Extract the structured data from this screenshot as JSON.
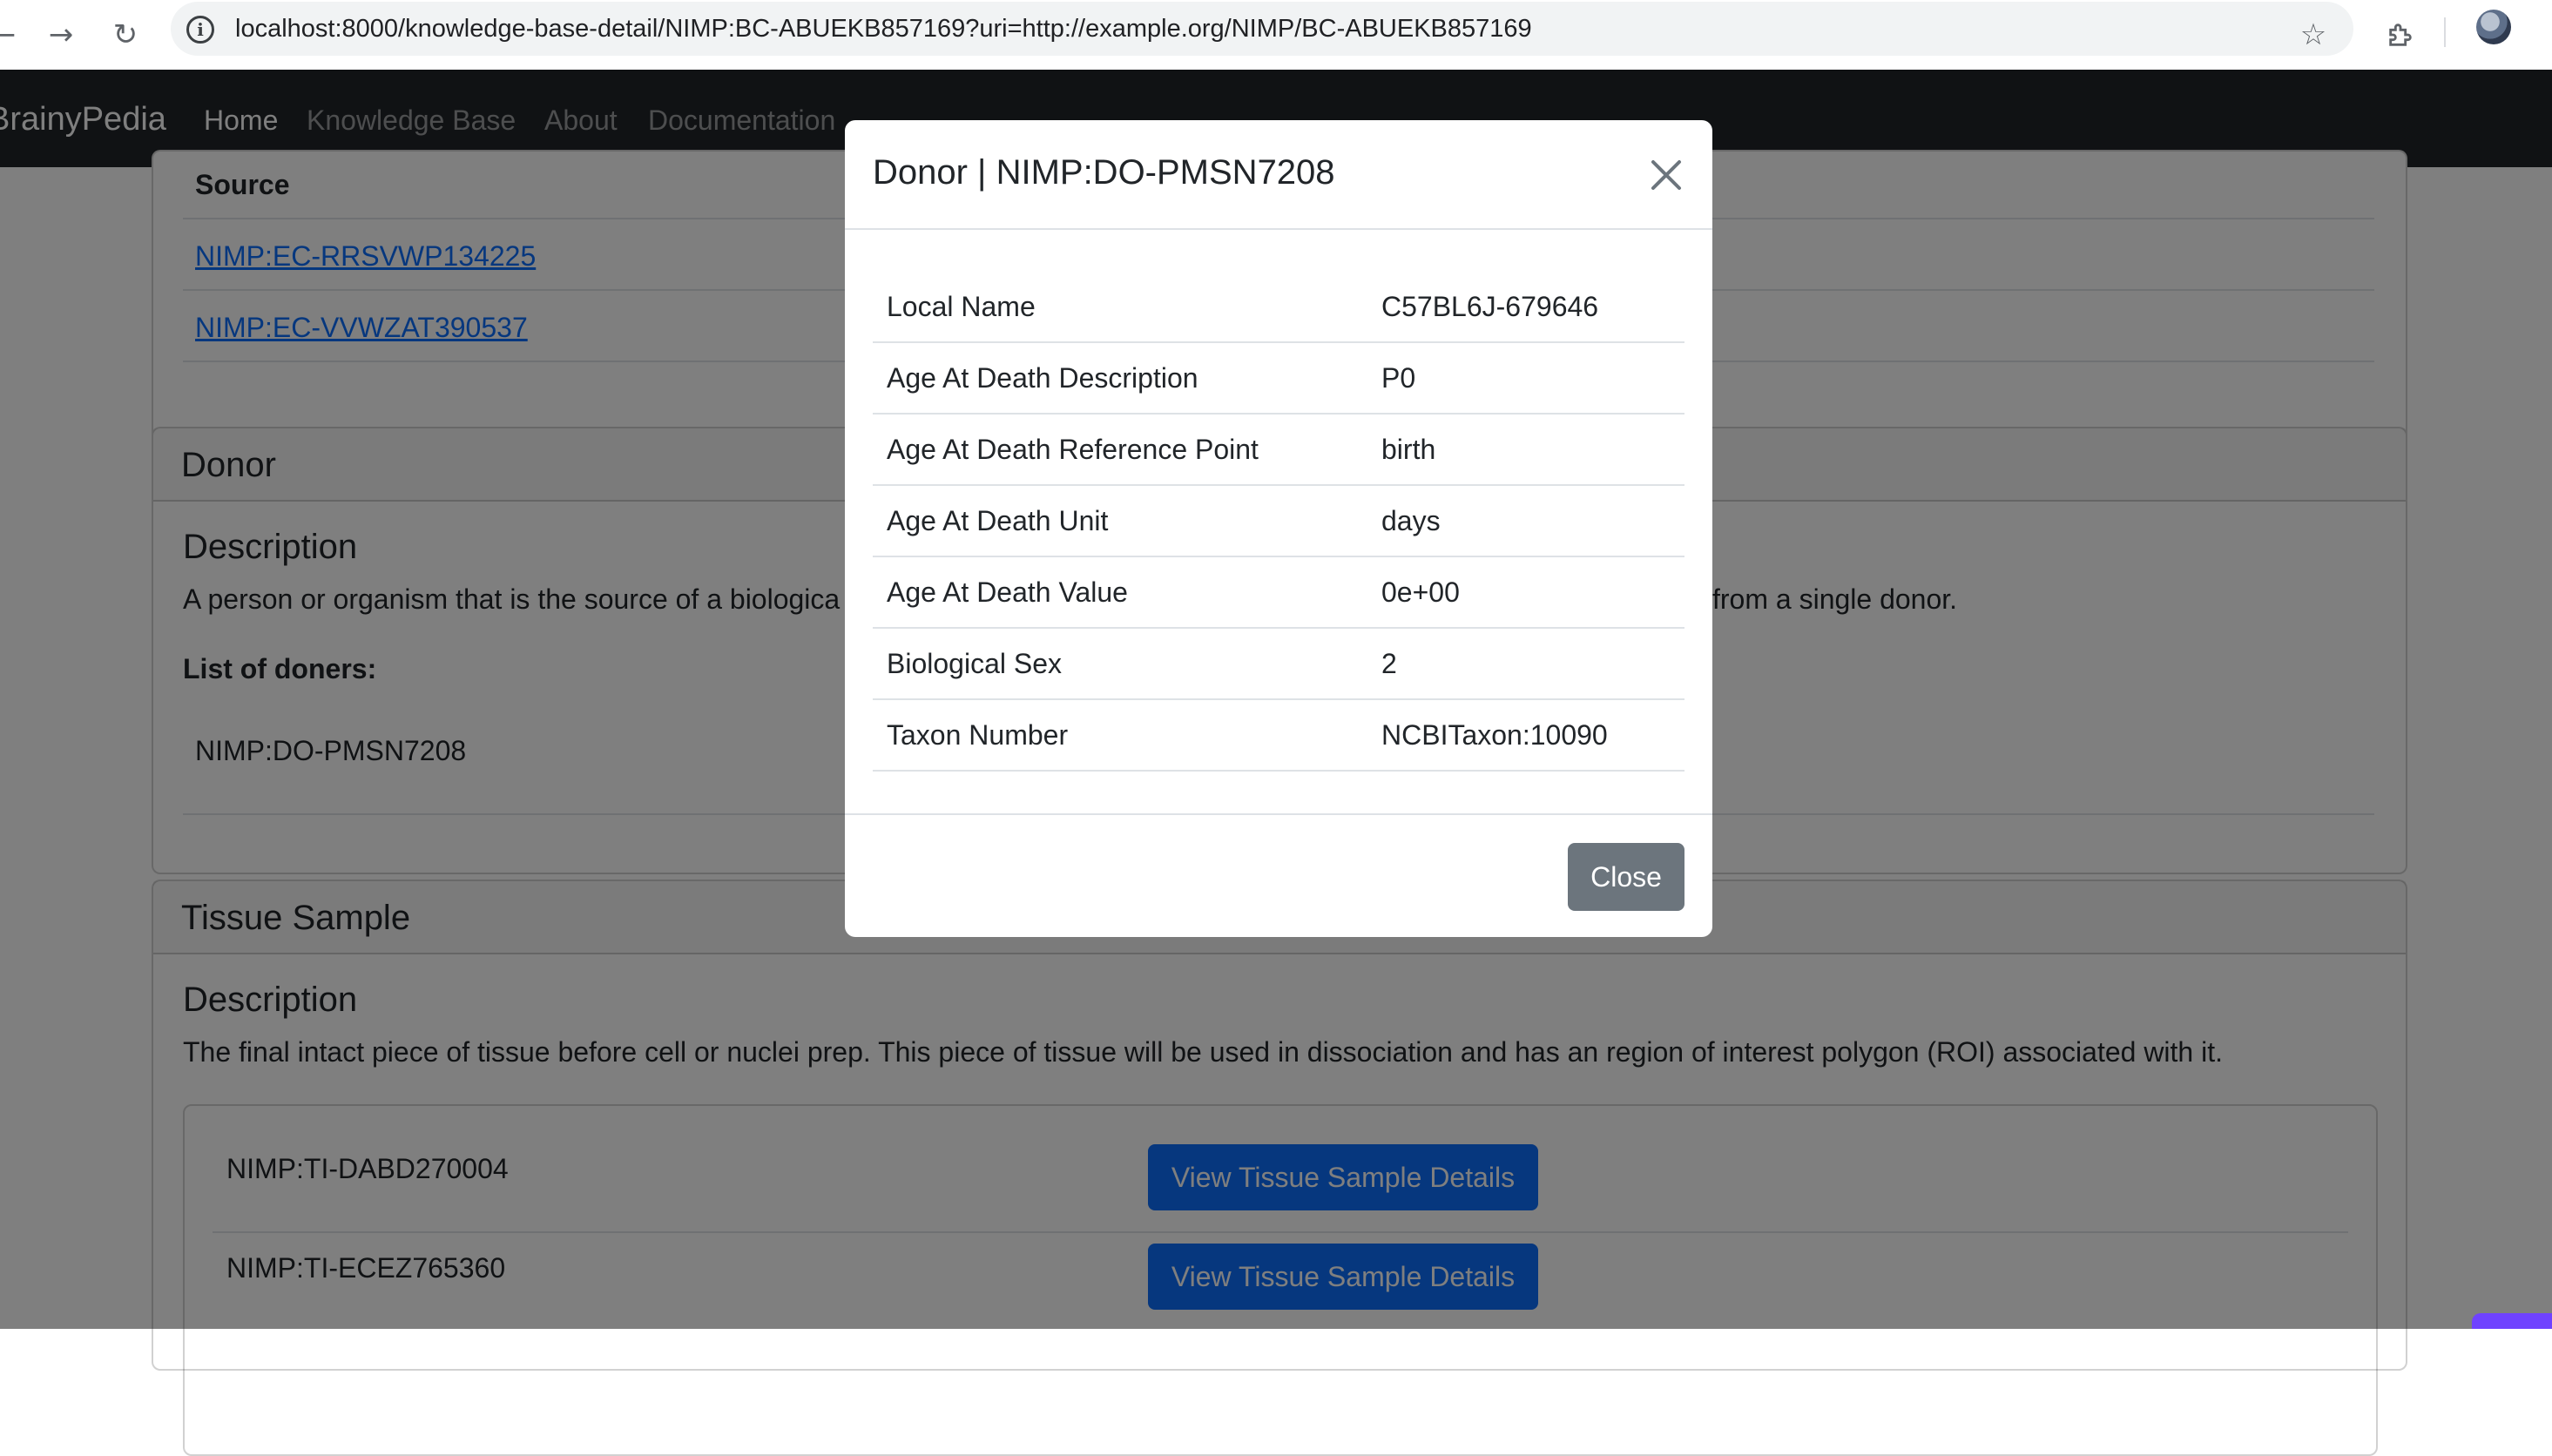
{
  "browser": {
    "url": "localhost:8000/knowledge-base-detail/NIMP:BC-ABUEKB857169?uri=http://example.org/NIMP/BC-ABUEKB857169"
  },
  "navbar": {
    "brand": "BrainyPedia",
    "links": [
      "Home",
      "Knowledge Base",
      "About",
      "Documentation"
    ]
  },
  "source_card": {
    "header": "Source",
    "links": [
      "NIMP:EC-RRSVWP134225",
      "NIMP:EC-VVWZAT390537"
    ]
  },
  "donor_card": {
    "title": "Donor",
    "description_heading": "Description",
    "description_start": "A person or organism that is the source of a biologica",
    "description_end": "from a single donor.",
    "list_heading": "List of doners:",
    "donor_id": "NIMP:DO-PMSN7208"
  },
  "tissue_card": {
    "title": "Tissue Sample",
    "description_heading": "Description",
    "description": "The final intact piece of tissue before cell or nuclei prep. This piece of tissue will be used in dissociation and has an region of interest polygon (ROI) associated with it.",
    "samples": [
      {
        "id": "NIMP:TI-DABD270004",
        "button": "View Tissue Sample Details"
      },
      {
        "id": "NIMP:TI-ECEZ765360",
        "button": "View Tissue Sample Details"
      }
    ]
  },
  "modal": {
    "title": "Donor | NIMP:DO-PMSN7208",
    "rows": [
      {
        "key": "Local Name",
        "value": "C57BL6J-679646"
      },
      {
        "key": "Age At Death Description",
        "value": "P0"
      },
      {
        "key": "Age At Death Reference Point",
        "value": "birth"
      },
      {
        "key": "Age At Death Unit",
        "value": "days"
      },
      {
        "key": "Age At Death Value",
        "value": "0e+00"
      },
      {
        "key": "Biological Sex",
        "value": "2"
      },
      {
        "key": "Taxon Number",
        "value": "NCBITaxon:10090"
      }
    ],
    "close_label": "Close"
  },
  "colors": {
    "navbar": "#212529",
    "primary": "#0d6efd",
    "secondary": "#6c757d",
    "backdrop": "rgba(0,0,0,0.5)"
  },
  "icons": [
    "back-arrow-icon",
    "forward-arrow-icon",
    "reload-icon",
    "site-info-icon",
    "bookmark-star-icon",
    "extensions-icon",
    "close-icon"
  ]
}
